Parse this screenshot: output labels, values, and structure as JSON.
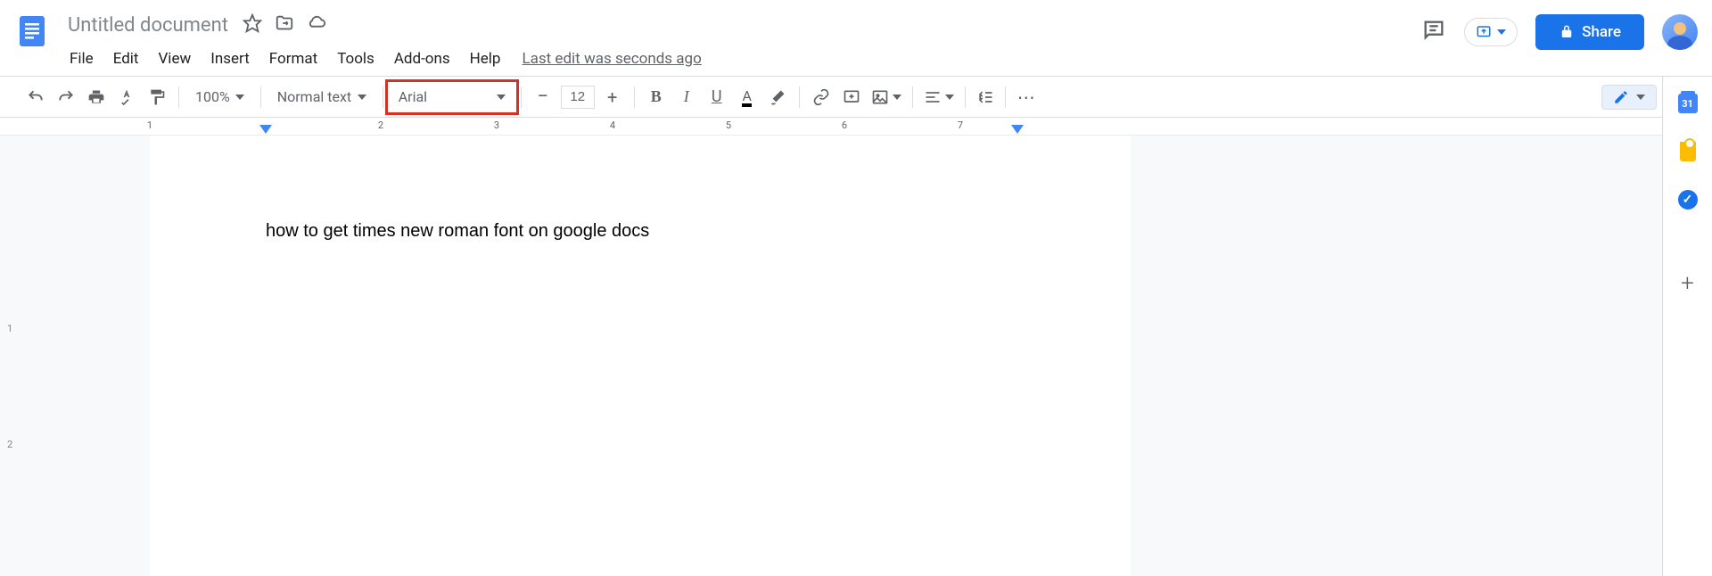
{
  "header": {
    "doc_title": "Untitled document",
    "last_edit": "Last edit was seconds ago",
    "share_label": "Share"
  },
  "menus": [
    "File",
    "Edit",
    "View",
    "Insert",
    "Format",
    "Tools",
    "Add-ons",
    "Help"
  ],
  "toolbar": {
    "zoom": "100%",
    "style": "Normal text",
    "font": "Arial",
    "font_size": "12"
  },
  "ruler_labels": [
    "1",
    "2",
    "3",
    "4",
    "5",
    "6",
    "7"
  ],
  "document": {
    "content": "how to get times new roman font on google docs"
  },
  "sidepanel": {
    "calendar_day": "31"
  },
  "vruler": [
    "1",
    "2"
  ]
}
